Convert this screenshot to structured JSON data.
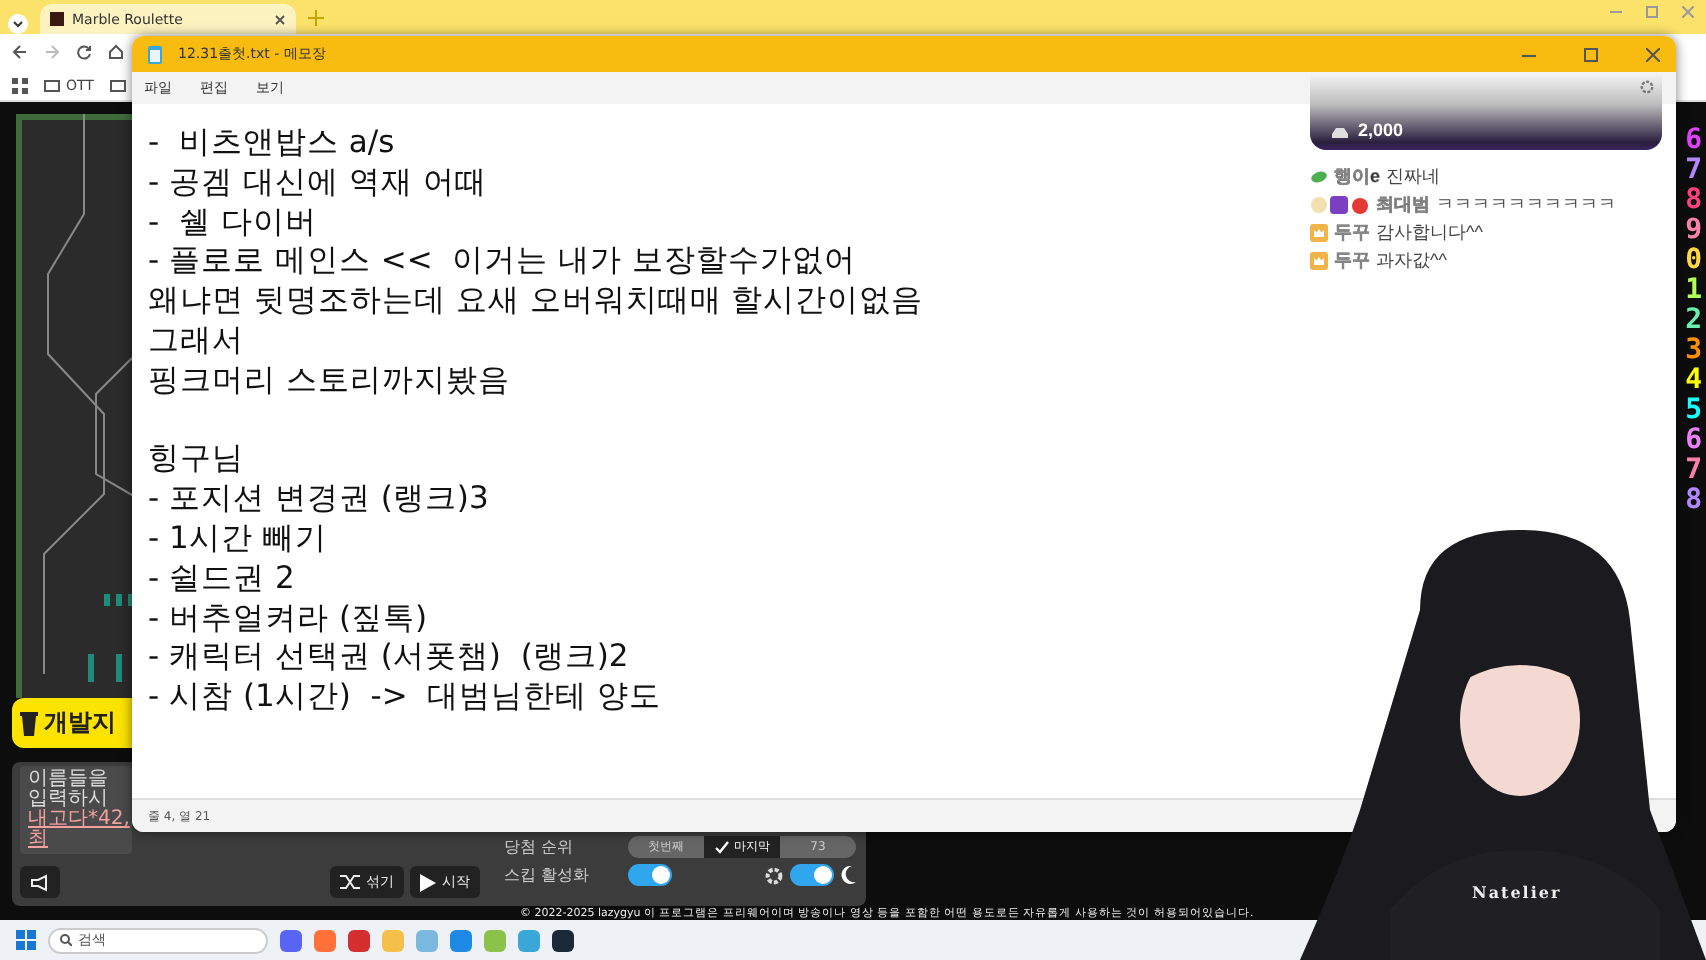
{
  "browser": {
    "tab": {
      "title": "Marble Roulette",
      "selected": true
    },
    "bookmarks": [
      {
        "label": "OTT"
      }
    ]
  },
  "game": {
    "brand_button": "개발지",
    "names_label": "이름들을 입력하시",
    "names_value": "내고다*42, 최",
    "numbers": [
      "6",
      "7",
      "8",
      "9",
      "0",
      "1",
      "2",
      "3",
      "4",
      "5",
      "6",
      "7",
      "8"
    ],
    "rank_label": "당첨 순위",
    "rank_options": [
      {
        "label": "첫번째",
        "selected": false
      },
      {
        "label": "마지막",
        "selected": true
      },
      {
        "label": "73",
        "selected": false
      }
    ],
    "skip_label": "스킵 활성화",
    "skip_on": true,
    "shuffle_button": "섞기",
    "start_button": "시작",
    "dark_mode_on": true,
    "footer": "© 2022-2025 lazygyu 이 프로그램은 프리웨어이며 방송이나 영상 등을 포함한 어떤 용도로든 자유롭게 사용하는 것이 허용되어있습니다."
  },
  "notepad": {
    "title": "12.31출첫.txt - 메모장",
    "menu": [
      "파일",
      "편집",
      "보기"
    ],
    "blocks": [
      [
        "-  비츠앤밥스 a/s",
        "- 공겜 대신에 역재 어때",
        "-  쉘 다이버",
        "- 플로로 메인스 <<  이거는 내가 보장할수가없어",
        "왜냐면 뒷명조하는데 요새 오버워치때매 할시간이없음",
        "그래서",
        "핑크머리 스토리까지봤음"
      ],
      [
        "힝구님",
        "- 포지션 변경권 (랭크)3",
        "- 1시간 빼기",
        "- 쉴드권 2",
        "- 버추얼켜라 (짚톡)",
        "- 캐릭터 선택권 (서폿챔)  (랭크)2",
        "- 시참 (1시간)  ->  대범님한테 양도"
      ]
    ],
    "status": "줄 4, 열 21"
  },
  "chat": {
    "donation": "2,000",
    "messages": [
      {
        "kind": "leaf",
        "name": "행이e",
        "text": "진짜네"
      },
      {
        "kind": "badges",
        "name": "최대범",
        "text": "ㅋㅋㅋㅋㅋㅋㅋㅋㅋㅋ"
      },
      {
        "kind": "crown",
        "name": "두꾸",
        "text": "감사합니다^^"
      },
      {
        "kind": "crown",
        "name": "두꾸",
        "text": "과자값^^"
      }
    ]
  },
  "avatar": {
    "shirt_text": "Natelier"
  },
  "taskbar": {
    "search": "검색"
  }
}
